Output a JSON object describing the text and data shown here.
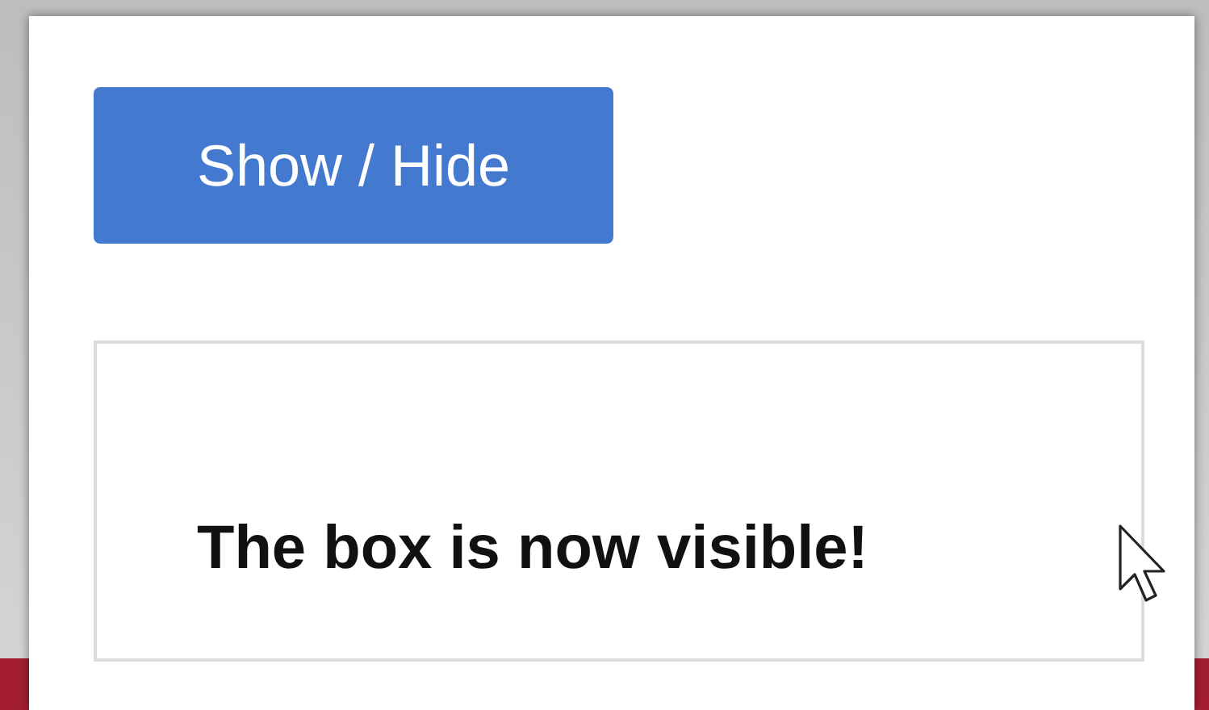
{
  "button": {
    "label": "Show / Hide"
  },
  "box": {
    "visible": true,
    "message": "The box is now visible!"
  }
}
